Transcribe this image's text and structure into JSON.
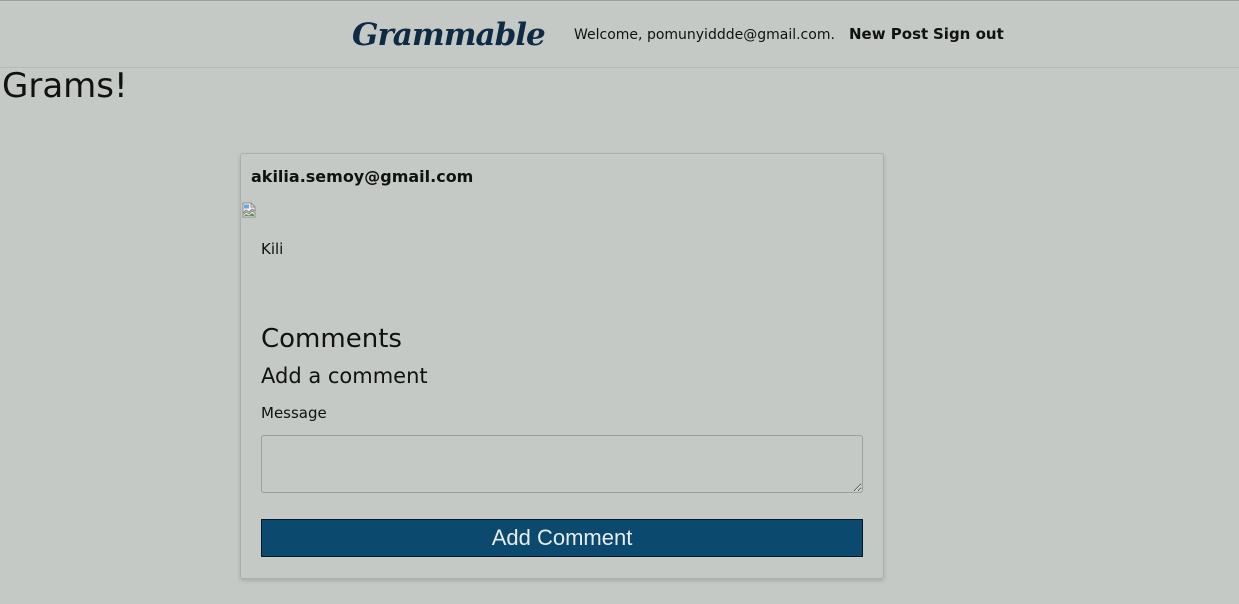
{
  "nav": {
    "brand": "Grammable",
    "welcome": "Welcome, pomunyiddde@gmail.com.",
    "new_post": "New Post",
    "sign_out": "Sign out"
  },
  "page": {
    "title": "Grams!"
  },
  "post": {
    "author": "akilia.semoy@gmail.com",
    "image_icon": "broken-image-icon",
    "caption": "Kili",
    "comments_heading": "Comments",
    "add_comment_heading": "Add a comment",
    "message_label": "Message",
    "message_value": "",
    "submit_label": "Add Comment"
  },
  "colors": {
    "background": "#c4c9c5",
    "brand": "#0e2a44",
    "button": "#0b4a6e"
  }
}
